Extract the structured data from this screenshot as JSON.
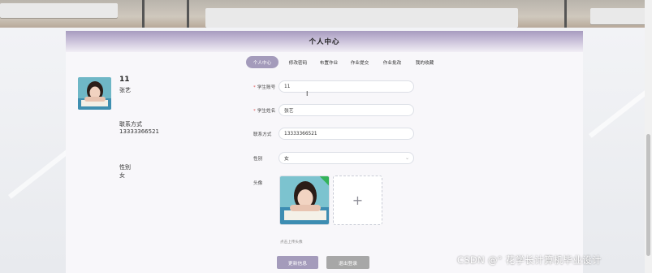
{
  "page": {
    "title": "个人中心"
  },
  "profile": {
    "account": "11",
    "name": "张艺",
    "contact_label": "联系方式",
    "contact_value": "13333366521",
    "gender_label": "性别",
    "gender_value": "女"
  },
  "tabs": [
    {
      "label": "个人中心",
      "active": true
    },
    {
      "label": "修改密码",
      "active": false
    },
    {
      "label": "布置作业",
      "active": false
    },
    {
      "label": "作业提交",
      "active": false
    },
    {
      "label": "作业批改",
      "active": false
    },
    {
      "label": "我的收藏",
      "active": false
    }
  ],
  "form": {
    "account_label": "学生账号",
    "account_value": "11",
    "name_label": "学生姓名",
    "name_value": "张艺",
    "phone_label": "联系方式",
    "phone_value": "13333366521",
    "gender_label": "性别",
    "gender_value": "女",
    "avatar_label": "头像",
    "upload_hint": "点击上传头像",
    "upload_plus": "+"
  },
  "buttons": {
    "update": "更新信息",
    "logout": "退出登录"
  },
  "colors": {
    "accent": "#a49bbb",
    "secondary_button": "#a7a7a7",
    "required_mark": "#e05a5a"
  },
  "watermark": "CSDN @° 花学长计算机毕业设计"
}
